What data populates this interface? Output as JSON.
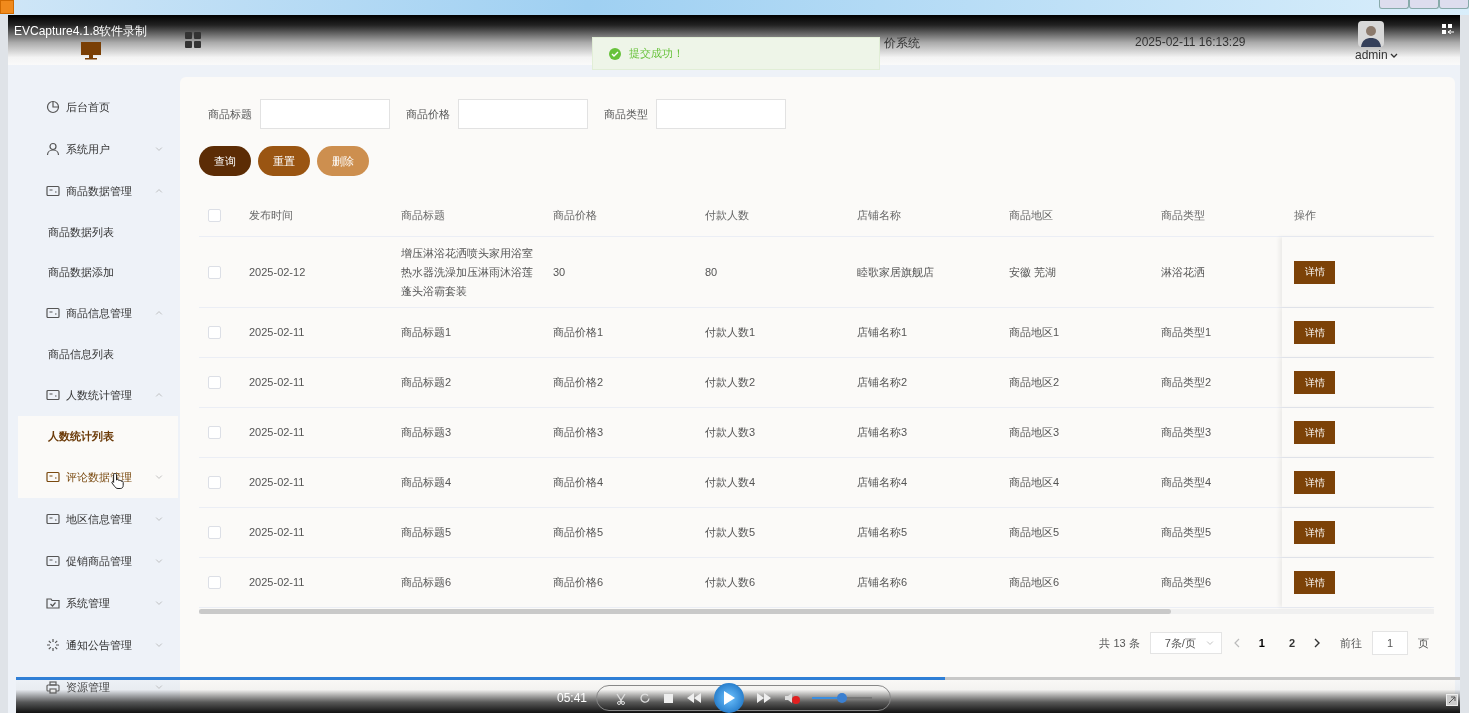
{
  "app_window": {
    "title": "EVCapture4.1.8软件录制"
  },
  "header": {
    "system_name": "价系统",
    "datetime": "2025-02-11 16:13:29",
    "user": "admin"
  },
  "toast": {
    "message": "提交成功！"
  },
  "sidebar": {
    "items": [
      {
        "label": "后台首页"
      },
      {
        "label": "系统用户",
        "expanded": false,
        "hovered": false
      },
      {
        "label": "商品数据管理",
        "expanded": true,
        "hovered": false,
        "children": [
          {
            "label": "商品数据列表",
            "selected": false
          },
          {
            "label": "商品数据添加",
            "selected": false
          }
        ]
      },
      {
        "label": "商品信息管理",
        "expanded": true,
        "hovered": false,
        "children": [
          {
            "label": "商品信息列表",
            "selected": false
          }
        ]
      },
      {
        "label": "人数统计管理",
        "expanded": true,
        "hovered": false,
        "children": [
          {
            "label": "人数统计列表",
            "selected": true
          }
        ]
      },
      {
        "label": "评论数据管理",
        "expanded": false,
        "hovered": true
      },
      {
        "label": "地区信息管理",
        "expanded": false,
        "hovered": false
      },
      {
        "label": "促销商品管理",
        "expanded": false,
        "hovered": false
      },
      {
        "label": "系统管理",
        "expanded": false,
        "hovered": false
      },
      {
        "label": "通知公告管理",
        "expanded": false,
        "hovered": false
      },
      {
        "label": "资源管理",
        "expanded": false,
        "hovered": false
      }
    ]
  },
  "search": {
    "fields": [
      {
        "label": "商品标题"
      },
      {
        "label": "商品价格"
      },
      {
        "label": "商品类型"
      }
    ],
    "buttons": [
      {
        "label": "查询",
        "color": "#5c2c05"
      },
      {
        "label": "重置",
        "color": "#9a5512"
      },
      {
        "label": "删除",
        "color": "#cd8f4f"
      }
    ]
  },
  "table": {
    "select_all": {
      "checked": false
    },
    "columns": [
      "发布时间",
      "商品标题",
      "商品价格",
      "付款人数",
      "店铺名称",
      "商品地区",
      "商品类型",
      "操作"
    ],
    "rows": [
      {
        "checked": false,
        "cells": [
          "2025-02-12",
          "增压淋浴花洒喷头家用浴室热水器洗澡加压淋雨沐浴莲蓬头浴霸套装",
          "30",
          "80",
          "睦歌家居旗舰店",
          "安徽 芜湖",
          "淋浴花洒"
        ],
        "action": "详情"
      },
      {
        "checked": false,
        "cells": [
          "2025-02-11",
          "商品标题1",
          "商品价格1",
          "付款人数1",
          "店铺名称1",
          "商品地区1",
          "商品类型1"
        ],
        "action": "详情"
      },
      {
        "checked": false,
        "cells": [
          "2025-02-11",
          "商品标题2",
          "商品价格2",
          "付款人数2",
          "店铺名称2",
          "商品地区2",
          "商品类型2"
        ],
        "action": "详情"
      },
      {
        "checked": false,
        "cells": [
          "2025-02-11",
          "商品标题3",
          "商品价格3",
          "付款人数3",
          "店铺名称3",
          "商品地区3",
          "商品类型3"
        ],
        "action": "详情"
      },
      {
        "checked": false,
        "cells": [
          "2025-02-11",
          "商品标题4",
          "商品价格4",
          "付款人数4",
          "店铺名称4",
          "商品地区4",
          "商品类型4"
        ],
        "action": "详情"
      },
      {
        "checked": false,
        "cells": [
          "2025-02-11",
          "商品标题5",
          "商品价格5",
          "付款人数5",
          "店铺名称5",
          "商品地区5",
          "商品类型5"
        ],
        "action": "详情"
      },
      {
        "checked": false,
        "cells": [
          "2025-02-11",
          "商品标题6",
          "商品价格6",
          "付款人数6",
          "店铺名称6",
          "商品地区6",
          "商品类型6"
        ],
        "action": "详情"
      }
    ]
  },
  "pagination": {
    "total": "共 13 条",
    "page_size": "7条/页",
    "pages": [
      {
        "label": "1",
        "selected": true
      },
      {
        "label": "2",
        "selected": false
      }
    ],
    "goto_label": "前往",
    "goto_value": "1",
    "goto_suffix": "页"
  },
  "player": {
    "time": "05:41",
    "progress": {
      "level": 0.64
    },
    "volume": {
      "level": 0.5
    },
    "muted": true
  }
}
